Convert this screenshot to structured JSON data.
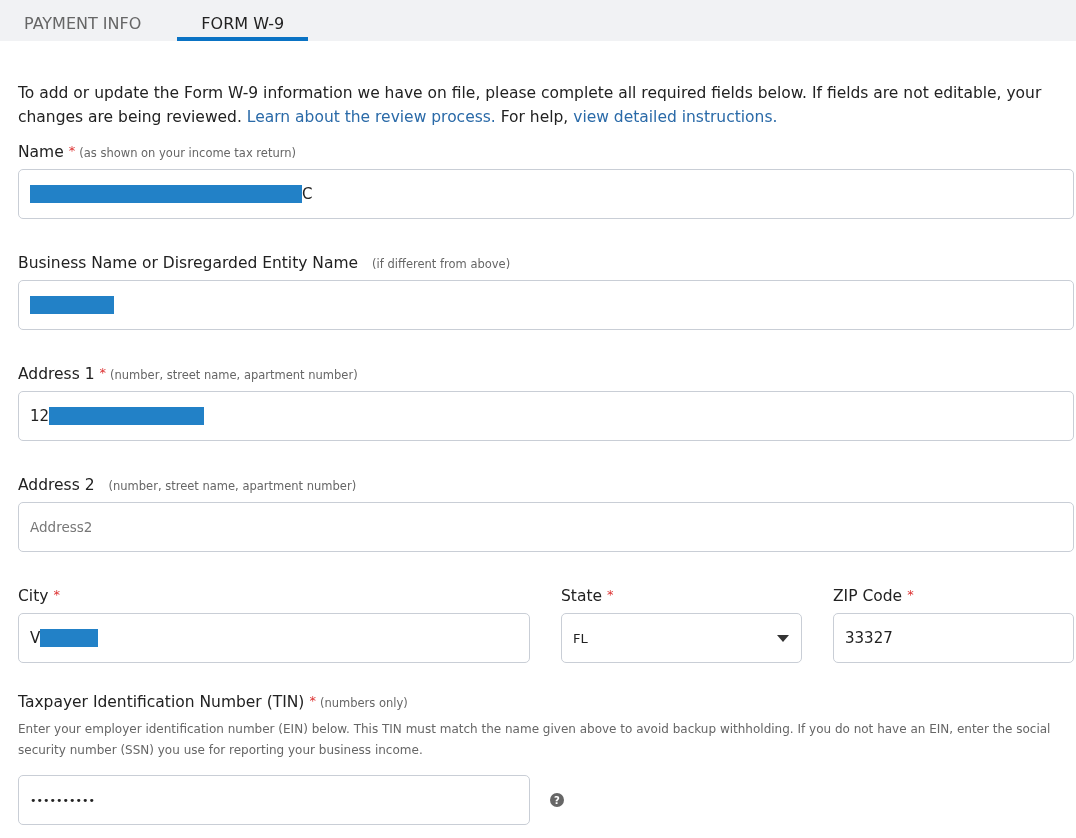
{
  "tabs": [
    {
      "label": "PAYMENT INFO",
      "selected": false
    },
    {
      "label": "FORM W-9",
      "selected": true
    }
  ],
  "intro": {
    "text": "To add or update the Form W-9 information we have on file, please complete all required fields below. If fields are not editable, your changes are being reviewed.",
    "link_1": "Learn about the review process.",
    "middle": "For help,",
    "link_2": "view detailed instructions."
  },
  "rows": [
    {
      "fields": [
        {
          "kind": "text",
          "label": "Name",
          "required_mark": "*",
          "hint": "(as shown on your income tax return)",
          "value": "C",
          "redacted_start": true
        }
      ]
    },
    {
      "fields": [
        {
          "kind": "text",
          "label": "Business Name or Disregarded Entity Name",
          "hint": "(if different from above)",
          "redacted_start": true
        }
      ]
    },
    {
      "fields": [
        {
          "kind": "text",
          "label": "Address 1",
          "required_mark": "*",
          "hint": "(number, street name, apartment number)",
          "value": "12",
          "redacted_end": true
        }
      ]
    },
    {
      "fields": [
        {
          "kind": "text",
          "label": "Address 2",
          "hint": "(number, street name, apartment number)",
          "placeholder": "Address2"
        }
      ]
    },
    {
      "fields": [
        {
          "kind": "text",
          "label": "City",
          "required_mark": "*",
          "value": "V",
          "redacted_end": true
        },
        {
          "kind": "select",
          "label": "State",
          "required_mark": "*",
          "value": "FL"
        },
        {
          "kind": "text",
          "label": "ZIP Code",
          "required_mark": "*",
          "value": "33327"
        }
      ]
    }
  ],
  "tin": {
    "label": "Taxpayer Identification Number (TIN)",
    "required_mark": "*",
    "hint": "(numbers only)",
    "description": "Enter your employer identification number (EIN) below. This TIN must match the name given above to avoid backup withholding. If you do not have an EIN, enter the social security number (SSN) you use for reporting your business income.",
    "value": "••••••••••",
    "help": "?"
  }
}
